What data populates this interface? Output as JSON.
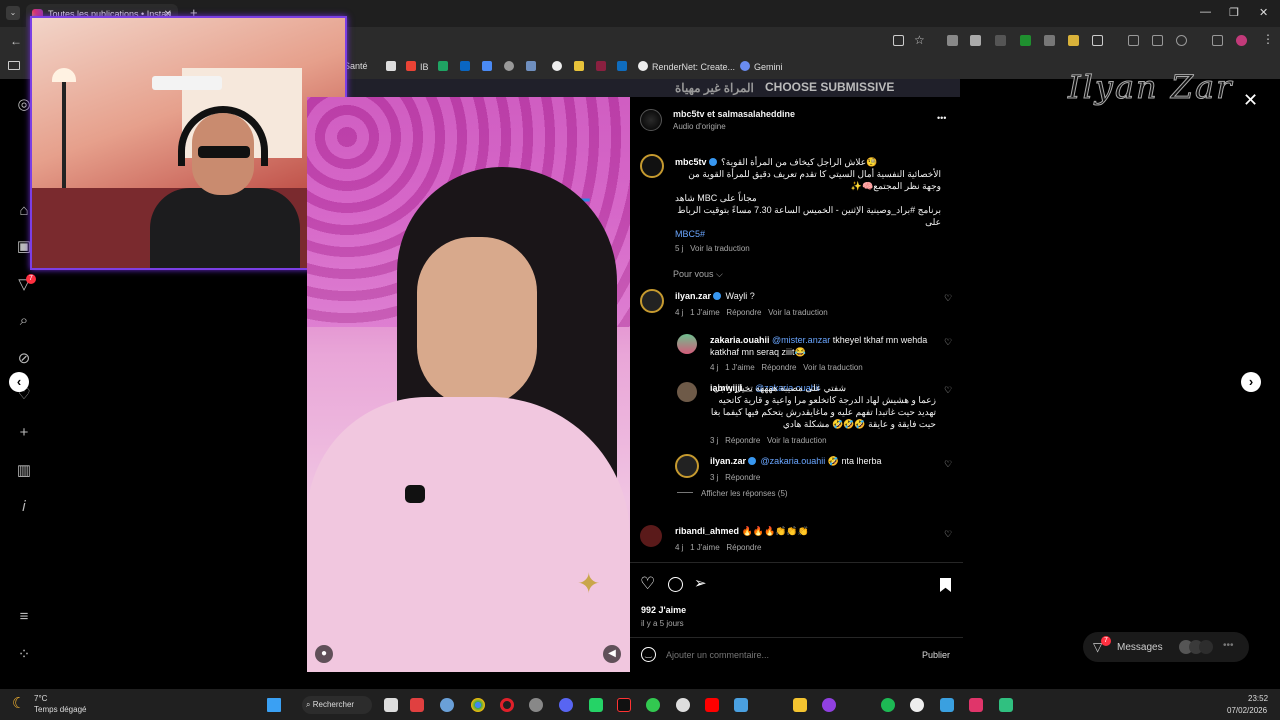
{
  "browser": {
    "tab_title": "Toutes les publications • Instag",
    "tab_close": "✕",
    "new_tab": "+",
    "win_min": "—",
    "win_max": "❐",
    "win_close": "✕",
    "bookmarks": [
      {
        "label": "Santé"
      },
      {
        "label": "IB"
      },
      {
        "label": "RenderNet: Create..."
      },
      {
        "label": "Gemini"
      }
    ]
  },
  "page": {
    "banner_text": "المراة غير مهياة",
    "banner_text2": "CHOOSE SUBMISSIVE",
    "watermark": "Ilyan Zar",
    "close": "✕",
    "prev": "‹",
    "next": "›"
  },
  "post": {
    "header_users": "mbc5tv et salmasalaheddine",
    "header_sub": "Audio d'origine",
    "more": "•••",
    "caption_user": "mbc5tv",
    "caption_line1": "علاش الراجل كيخاف من المرأة القوية؟🧐",
    "caption_line2": "الأخصائية النفسية أمال السيتي كا تقدم تعريف دقيق للمرأة القوية من وجهة نظر المجتمع🧠✨",
    "caption_line3": "مجاناً على MBC شاهد",
    "caption_line4": "برنامج #براد_وصينية الإثنين - الخميس الساعة 7.30 مساءً بتوقيت الرباط على",
    "caption_tag": "MBC5#",
    "caption_time": "5 j",
    "caption_translate": "Voir la traduction",
    "for_you": "Pour vous ⌵",
    "comments": [
      {
        "user": "ilyan.zar",
        "text": "Wayli ?",
        "time": "4 j",
        "likes": "1 J'aime",
        "reply": "Répondre",
        "translate": "Voir la traduction"
      },
      {
        "user": "zakaria.ouahii",
        "mention": "@mister.anzar",
        "text": "tkheyel tkhaf mn wehda katkhaf mn seraq ziiit😂",
        "time": "4 j",
        "likes": "1 J'aime",
        "reply": "Répondre",
        "translate": "Voir la traduction"
      },
      {
        "user": "iamwijii__",
        "mention": "@zakaria.ouahii",
        "text": "شفتي على مصيبة ههههه تخيل راجل زعما و هشيش لهاد الدرجة كاتخلعو مرا واعية و قارية كاتحيه تهديد حيت غاتبدا تفهم عليه و ماغايقدرش يتحكم فيها كيفما بغا حيت فايقة و عايقة 🤣🤣🤣 مشكلة هادي",
        "time": "3 j",
        "reply": "Répondre",
        "translate": "Voir la traduction"
      },
      {
        "user": "ilyan.zar",
        "mention": "@zakaria.ouahii",
        "text": "🤣 nta lherba",
        "time": "3 j",
        "reply": "Répondre"
      },
      {
        "user": "ribandi_ahmed",
        "text": "🔥🔥🔥👏👏👏",
        "time": "4 j",
        "likes": "1 J'aime",
        "reply": "Répondre"
      }
    ],
    "show_replies": "Afficher les réponses (5)",
    "likes_count": "992 J'aime",
    "posted": "il y a 5 jours",
    "comment_placeholder": "Ajouter un commentaire...",
    "publish": "Publier"
  },
  "messages": {
    "label": "Messages",
    "badge": "7"
  },
  "notif_badge": "7",
  "taskbar": {
    "weather_temp": "7°C",
    "weather_desc": "Temps dégagé",
    "search": "Rechercher",
    "time": "23:52",
    "date": "07/02/2026"
  },
  "colors": {
    "accent": "#3897f0",
    "webcam_border": "#7b3fe4",
    "ig_bg": "#000000"
  }
}
